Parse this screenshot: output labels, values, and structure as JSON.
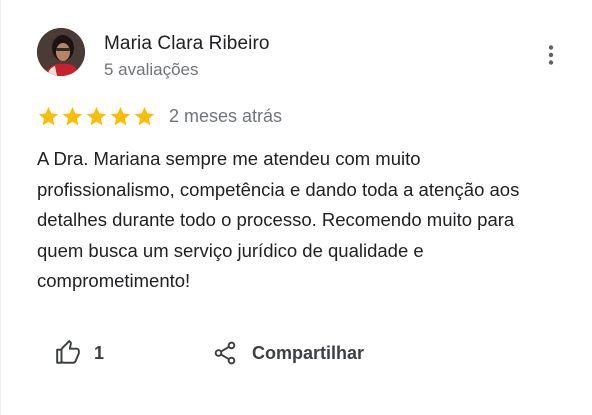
{
  "review": {
    "author_name": "Maria Clara Ribeiro",
    "author_reviews": "5 avaliações",
    "rating": 5,
    "rating_max": 5,
    "date": "2 meses atrás",
    "text": "A Dra. Mariana sempre me atendeu com muito profissionalismo, competência e dando toda a atenção aos detalhes durante todo o processo. Recomendo muito para quem busca um serviço jurídico de qualidade e comprometimento!"
  },
  "actions": {
    "like_count": "1",
    "share_label": "Compartilhar"
  },
  "icons": {
    "menu": "more-vert-icon",
    "like": "thumb-up-icon",
    "share": "share-icon",
    "star": "star-icon"
  },
  "colors": {
    "star": "#fbbc04",
    "muted_text": "#70757a",
    "text": "#202124"
  }
}
